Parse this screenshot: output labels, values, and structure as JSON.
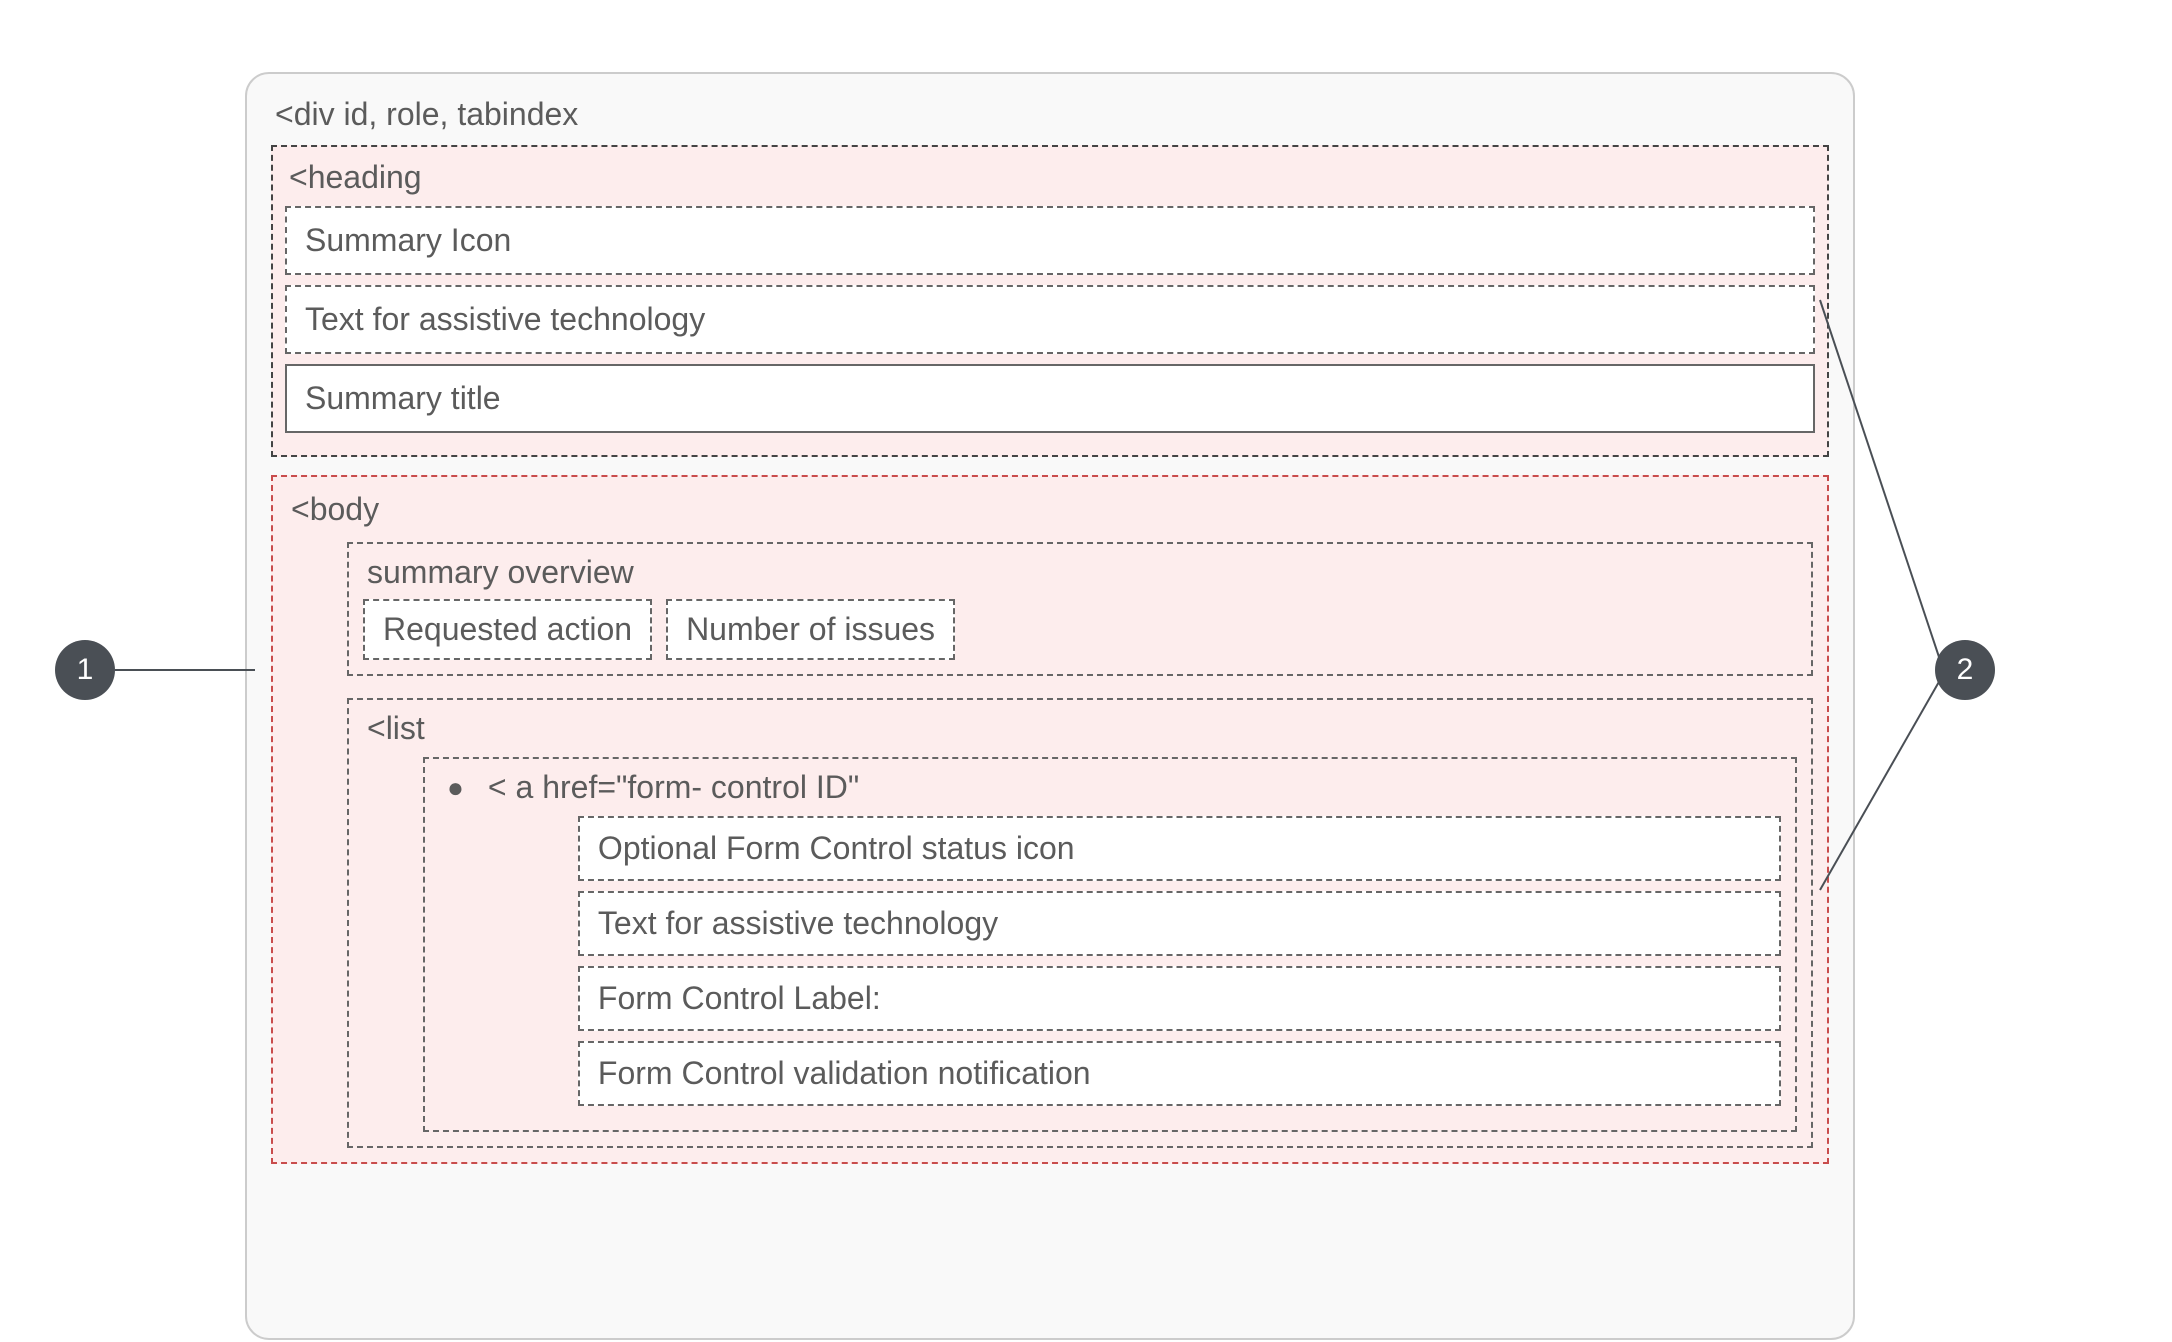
{
  "outer": {
    "label": "<div id, role, tabindex"
  },
  "heading": {
    "label": "<heading",
    "items": [
      "Summary Icon",
      "Text for assistive technology",
      "Summary title"
    ]
  },
  "bodySection": {
    "label": "<body",
    "overview": {
      "label": "summary overview",
      "items": [
        "Requested action",
        "Number of issues"
      ]
    },
    "list": {
      "label": "<list",
      "item": {
        "bullet": "●",
        "label": "< a href=\"form- control ID\"",
        "subs": [
          "Optional Form Control status icon",
          "Text for assistive technology",
          "Form Control Label:",
          "Form Control validation notification"
        ]
      }
    }
  },
  "callouts": {
    "left": "1",
    "right": "2"
  }
}
